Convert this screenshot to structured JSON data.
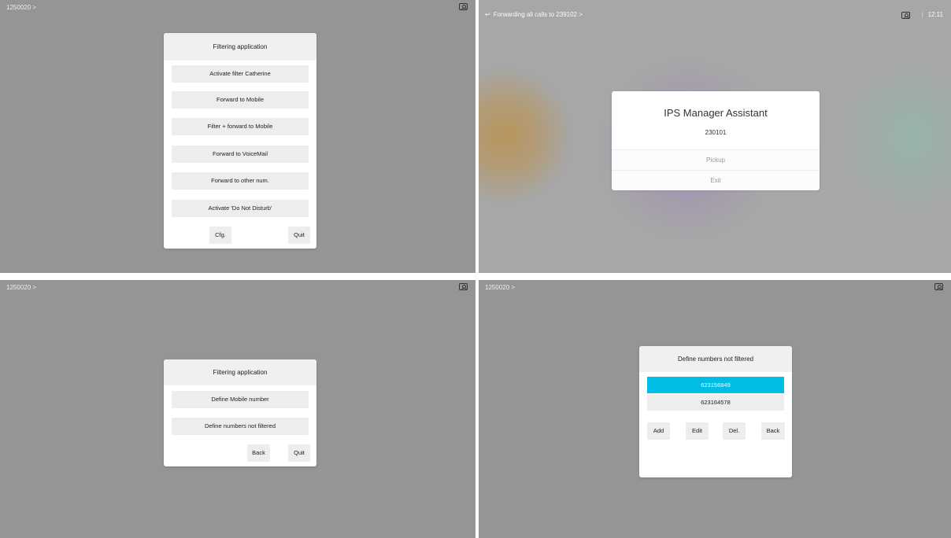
{
  "panel1": {
    "top_number": "1250020 >",
    "dialog_title": "Filtering application",
    "options": [
      "Activate filter Catherine",
      "Forward to Mobile",
      "Filter + forward to Mobile",
      "Forward to VoiceMail",
      "Forward to other num.",
      "Activate 'Do Not Disturb'"
    ],
    "cfg_label": "Cfg.",
    "quit_label": "Quit"
  },
  "panel2": {
    "forwarding_text": "Forwarding all calls to 239102 >",
    "time": "12:11",
    "separator": "|",
    "forward_icon": "↩",
    "dialog_title": "IPS Manager Assistant",
    "number": "230101",
    "pickup_label": "Pickup",
    "exit_label": "Exit"
  },
  "panel3": {
    "top_number": "1250020 >",
    "dialog_title": "Filtering application",
    "options": [
      "Define Mobile number",
      "Define numbers not filtered"
    ],
    "back_label": "Back",
    "quit_label": "Quit"
  },
  "panel4": {
    "top_number": "1250020 >",
    "dialog_title": "Define numbers not filtered",
    "numbers": [
      "623156849",
      "623164578"
    ],
    "add_label": "Add",
    "edit_label": "Edit",
    "del_label": "Del.",
    "back_label": "Back"
  },
  "colors": {
    "selected": "#00bde6"
  }
}
